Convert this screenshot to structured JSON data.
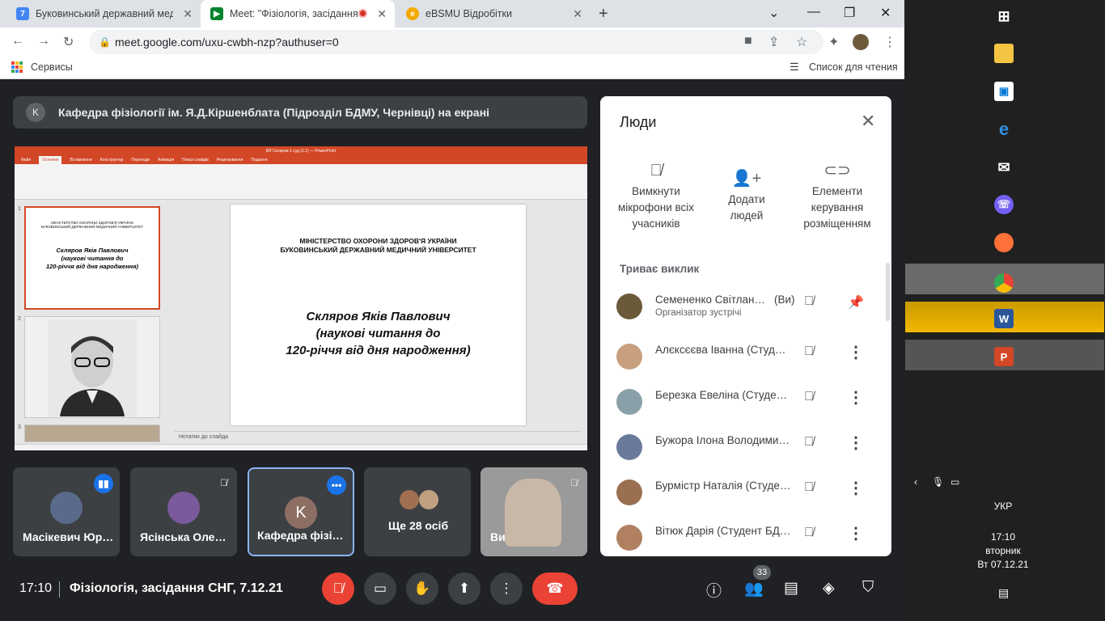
{
  "browser": {
    "tabs": [
      {
        "title": "Буковинський державний меди",
        "favicon": "7"
      },
      {
        "title": "Meet: \"Фізіологія, засідання",
        "favicon": "meet"
      },
      {
        "title": "eBSMU Відробітки",
        "favicon": "e"
      }
    ],
    "url": "meet.google.com/uxu-cwbh-nzp?authuser=0",
    "bookmarks_label": "Сервисы",
    "reading_list": "Список для чтения"
  },
  "presentation": {
    "avatar_letter": "K",
    "banner": "Кафедра фізіології ім. Я.Д.Кіршенблата (Підрозділ БДМУ, Чернівці) на екрані",
    "ppt_title": "ВЛ Скляров 1 суд (1.1) — PowerPoint",
    "ribbon_tabs": [
      "Файл",
      "Основне",
      "Вставлення",
      "Конструктор",
      "Переходи",
      "Анімація",
      "Показ слайдів",
      "Рецензування",
      "Подання"
    ],
    "slide_header": "МІНІСТЕРСТВО ОХОРОНИ ЗДОРОВ'Я УКРАЇНИ\nБУКОВИНСЬКИЙ ДЕРЖАВНИЙ МЕДИЧНИЙ УНІВЕРСИТЕТ",
    "slide_name": "Скляров Яків Павлович\n(наукові читання до\n120-річчя від дня народження)",
    "notes": "Нотатки до слайда",
    "thumb_numbers": [
      "1",
      "2",
      "3"
    ]
  },
  "tiles": [
    {
      "name": "Масікевич Юр…",
      "avatar_color": "#5a6a8a"
    },
    {
      "name": "Ясінська Оле…",
      "avatar_color": "#7a5a9a"
    },
    {
      "name": "Кафедра фізі…",
      "avatar_letter": "K",
      "avatar_color": "#8d6e63"
    },
    {
      "name": "Ще 28 осіб"
    },
    {
      "name": "Ви"
    }
  ],
  "bottom": {
    "time": "17:10",
    "meeting": "Фізіологія, засідання СНГ, 7.12.21",
    "participants_count": "33"
  },
  "panel": {
    "title": "Люди",
    "actions": [
      {
        "label": "Вимкнути мікрофони всіх учасників",
        "icon": "mic-off-icon"
      },
      {
        "label": "Додати людей",
        "icon": "add-person-icon"
      },
      {
        "label": "Елементи керування розміщенням",
        "icon": "toggle-icon"
      }
    ],
    "section": "Триває виклик",
    "people": [
      {
        "name": "Семененко Світлан…",
        "you": "(Ви)",
        "sub": "Організатор зустрічі",
        "color": "#6b5a3a"
      },
      {
        "name": "Алєксєєва Іванна (Студ…",
        "color": "#c8a080"
      },
      {
        "name": "Березка Евеліна (Студе…",
        "color": "#8aa0a8"
      },
      {
        "name": "Бужора Ілона Володими…",
        "color": "#6a7a9a"
      },
      {
        "name": "Бурмістр Наталія (Студе…",
        "color": "#9a7050"
      },
      {
        "name": "Вітюк Дарія (Студент БД…",
        "color": "#b08060"
      }
    ]
  },
  "taskbar": {
    "lang": "УКР",
    "time": "17:10",
    "day": "вторник",
    "date": "Вт 07.12.21"
  }
}
